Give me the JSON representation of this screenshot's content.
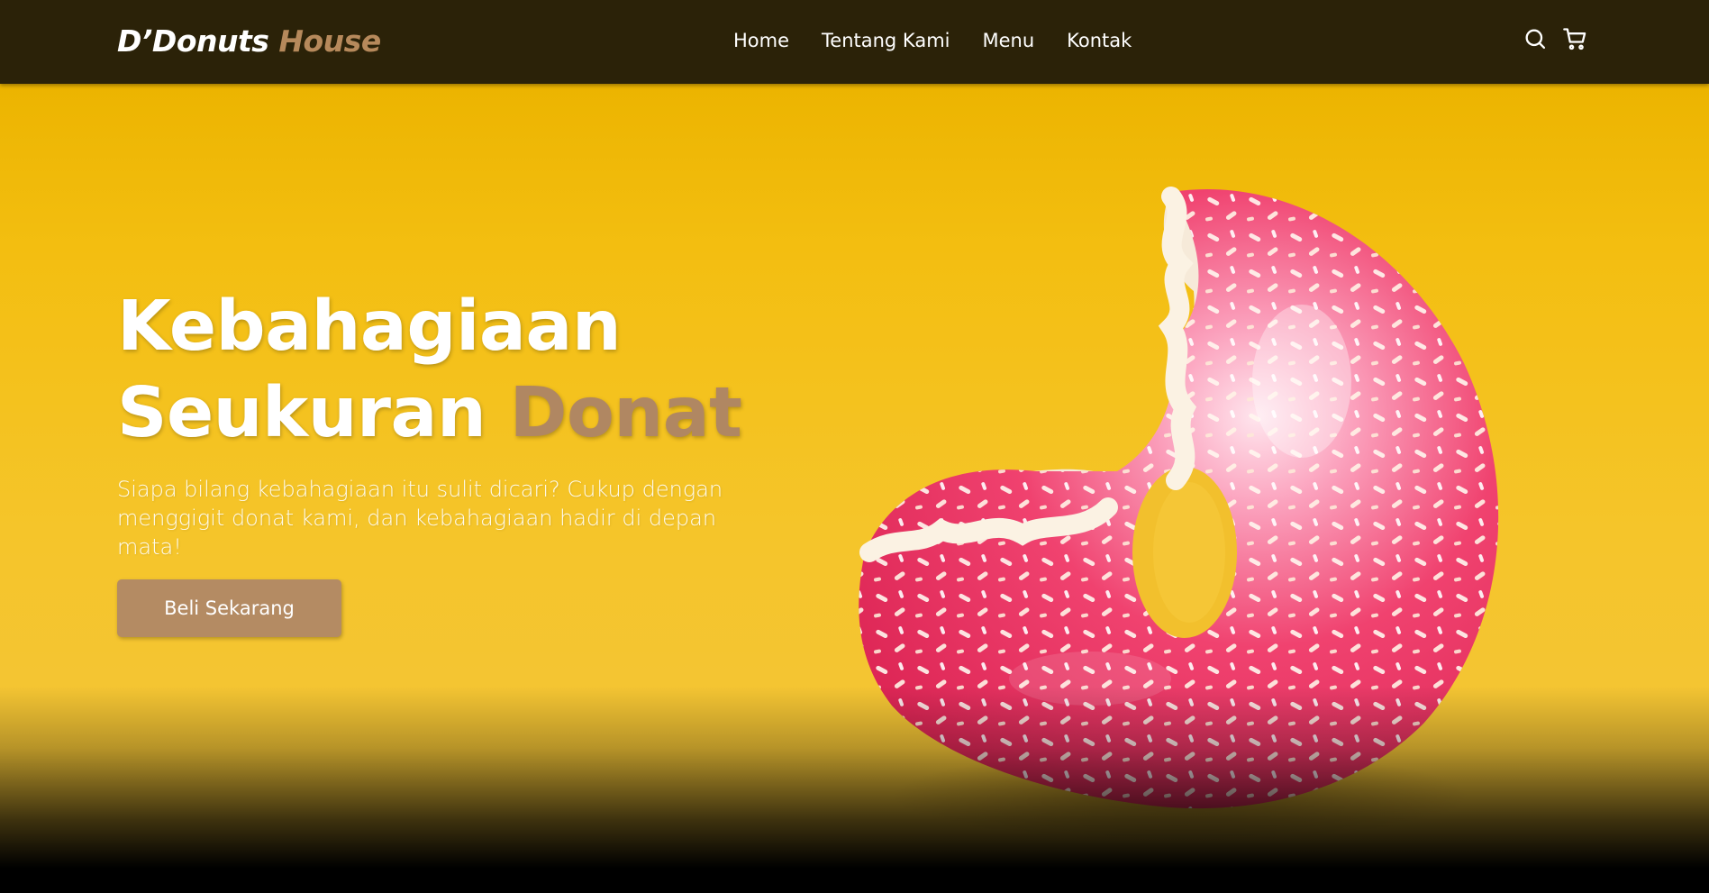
{
  "brand": {
    "name_main": "D’Donuts",
    "name_accent": " House"
  },
  "nav": {
    "links": [
      {
        "label": "Home"
      },
      {
        "label": "Tentang Kami"
      },
      {
        "label": "Menu"
      },
      {
        "label": "Kontak"
      }
    ],
    "icons": [
      "search-icon",
      "shopping-cart-icon"
    ]
  },
  "hero": {
    "title_line1": "Kebahagiaan",
    "title_line2": "Seukuran ",
    "title_accent": "Donat",
    "description": "Siapa bilang kebahagiaan itu sulit dicari? Cukup dengan menggigit donat kami, dan kebahagiaan hadir di depan mata!",
    "cta_label": "Beli Sekarang"
  },
  "colors": {
    "navbar_bg": "#2b2208",
    "accent": "#b48b63",
    "hero_bg": "#f3be10",
    "donut_icing": "#ee3e68"
  }
}
